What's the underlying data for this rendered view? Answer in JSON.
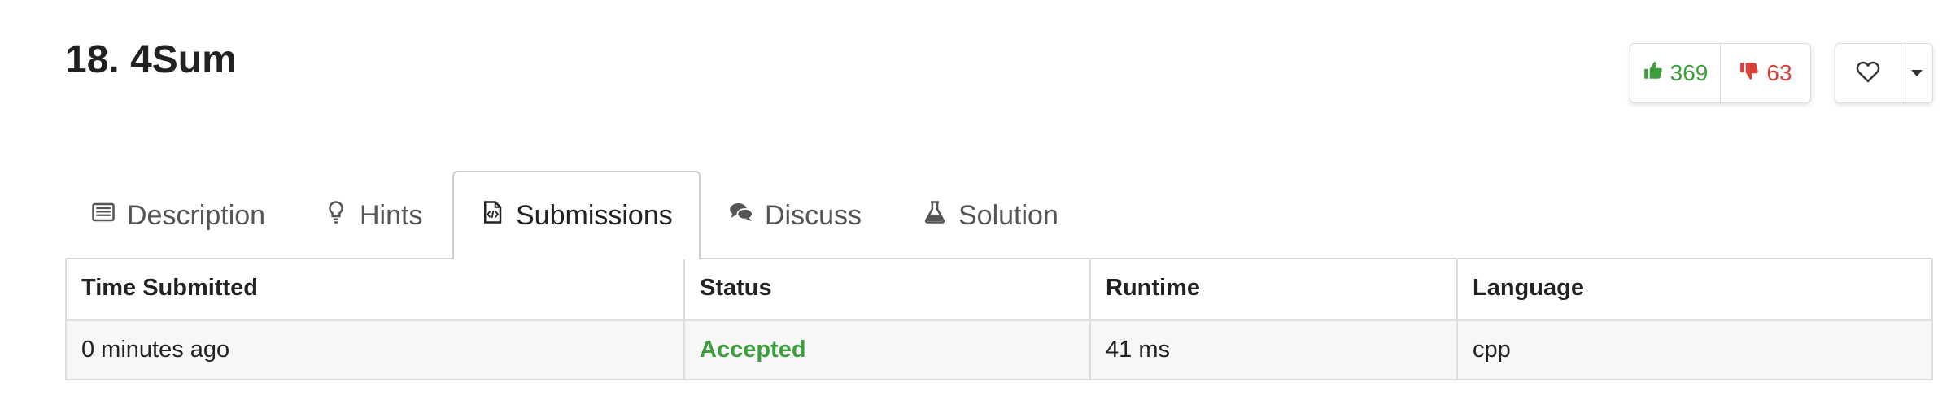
{
  "problem": {
    "title": "18. 4Sum"
  },
  "votes": {
    "up": "369",
    "down": "63"
  },
  "colors": {
    "accepted": "#3c9e3c",
    "upvote": "#3c9e3c",
    "downvote": "#d9403a"
  },
  "tabs": [
    {
      "label": "Description",
      "icon": "description-icon",
      "active": false
    },
    {
      "label": "Hints",
      "icon": "lightbulb-icon",
      "active": false
    },
    {
      "label": "Submissions",
      "icon": "code-file-icon",
      "active": true
    },
    {
      "label": "Discuss",
      "icon": "comments-icon",
      "active": false
    },
    {
      "label": "Solution",
      "icon": "flask-icon",
      "active": false
    }
  ],
  "submissions": {
    "headers": [
      "Time Submitted",
      "Status",
      "Runtime",
      "Language"
    ],
    "rows": [
      {
        "time": "0 minutes ago",
        "status": "Accepted",
        "runtime": "41 ms",
        "language": "cpp"
      }
    ]
  }
}
